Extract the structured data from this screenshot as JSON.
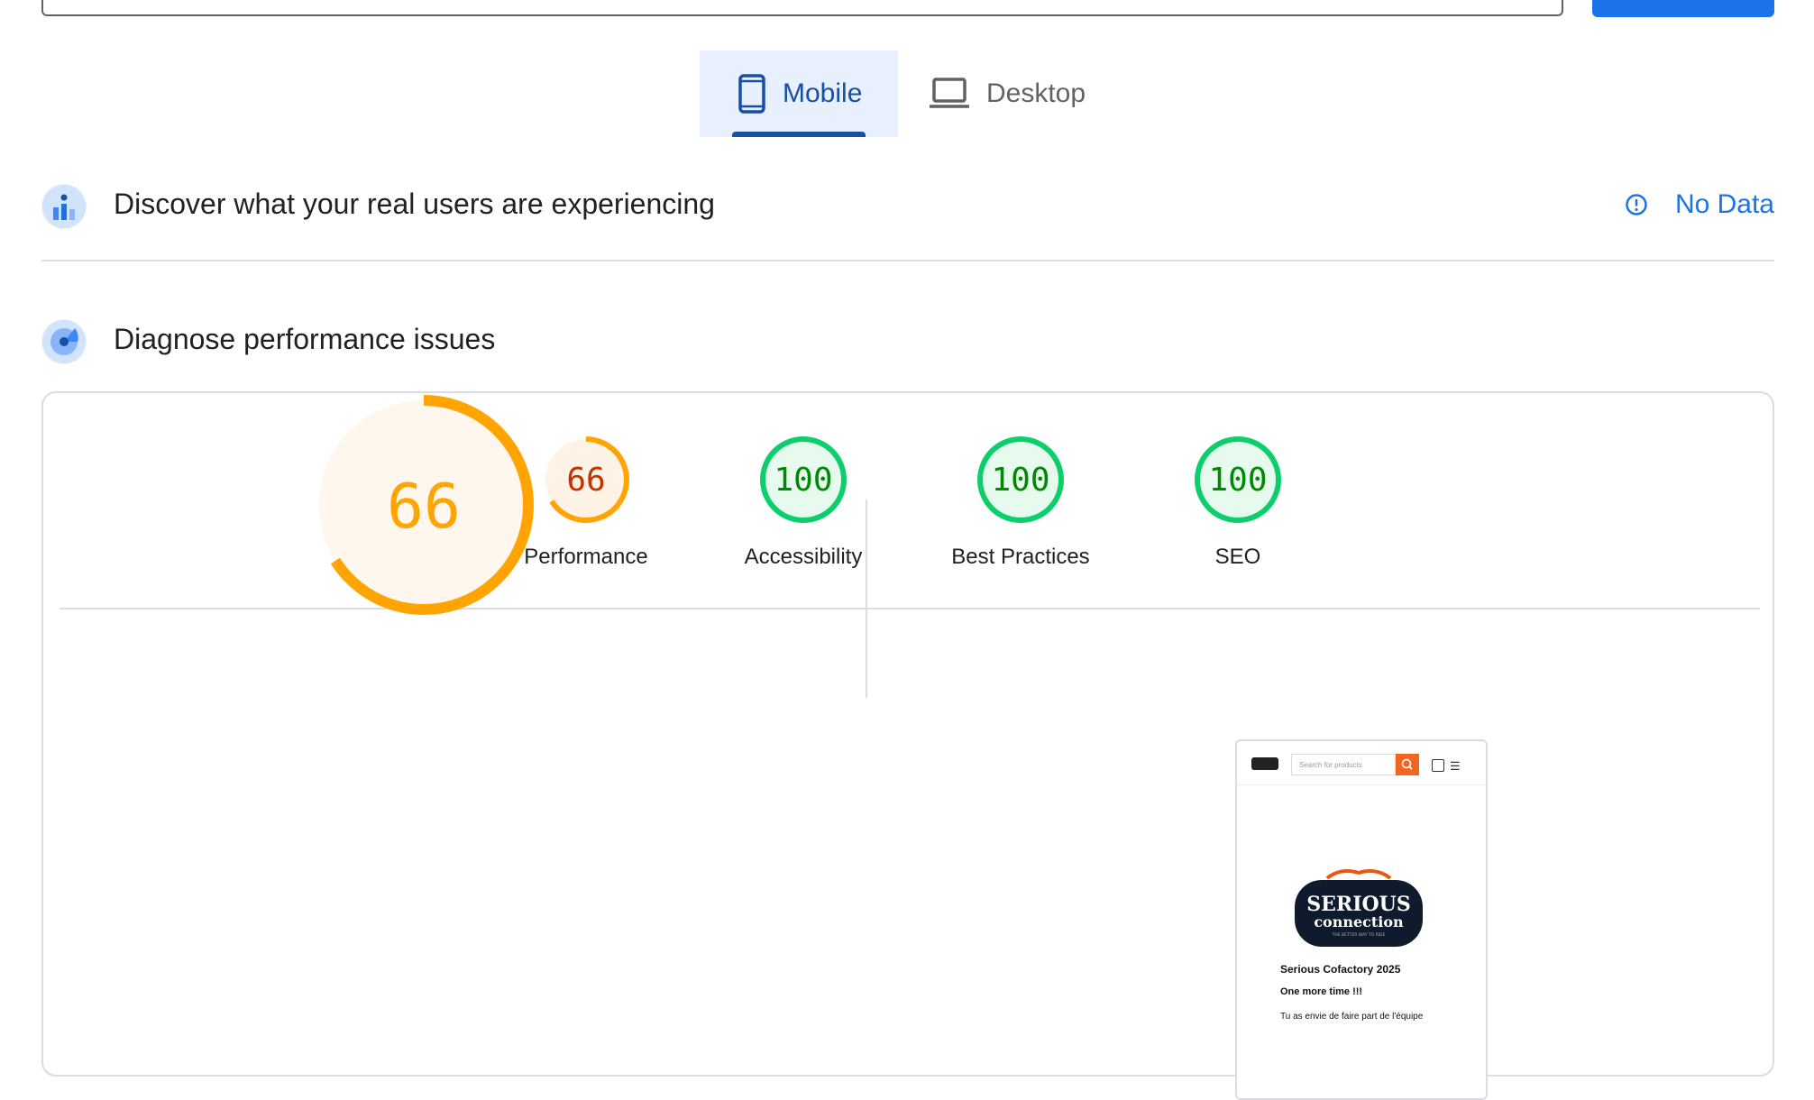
{
  "tabs": [
    {
      "label": "Mobile",
      "selected": true
    },
    {
      "label": "Desktop",
      "selected": false
    }
  ],
  "crux": {
    "title": "Discover what your real users are experiencing",
    "status": "No Data"
  },
  "diagnose": {
    "title": "Diagnose performance issues"
  },
  "scores": [
    {
      "label": "Performance",
      "value": "66",
      "fraction": 0.66,
      "color": "#ffa400",
      "text_color": "#c33300",
      "bg": "#fff3e6"
    },
    {
      "label": "Accessibility",
      "value": "100",
      "fraction": 1.0,
      "color": "#0cce6b",
      "text_color": "#008800",
      "bg": "#e6faee"
    },
    {
      "label": "Best Practices",
      "value": "100",
      "fraction": 1.0,
      "color": "#0cce6b",
      "text_color": "#008800",
      "bg": "#e6faee"
    },
    {
      "label": "SEO",
      "value": "100",
      "fraction": 1.0,
      "color": "#0cce6b",
      "text_color": "#008800",
      "bg": "#e6faee"
    }
  ],
  "main_score": {
    "value": "66",
    "fraction": 0.66,
    "color": "#ffa400",
    "text_color": "#e67700"
  },
  "thumbnail": {
    "search_placeholder": "Search for products",
    "logo_line1": "SERIOUS",
    "logo_line2": "connection",
    "logo_tagline": "THE BETTER WAY TO RIDE",
    "title": "Serious Cofactory 2025",
    "subtitle": "One more time !!!",
    "body": "Tu as envie de faire part de l'équipe"
  },
  "colors": {
    "accent": "#1a73e8",
    "tab_selected_bg": "#e8f0fe",
    "tab_selected_text": "#174ea6",
    "average": "#ffa400",
    "pass": "#0cce6b"
  }
}
